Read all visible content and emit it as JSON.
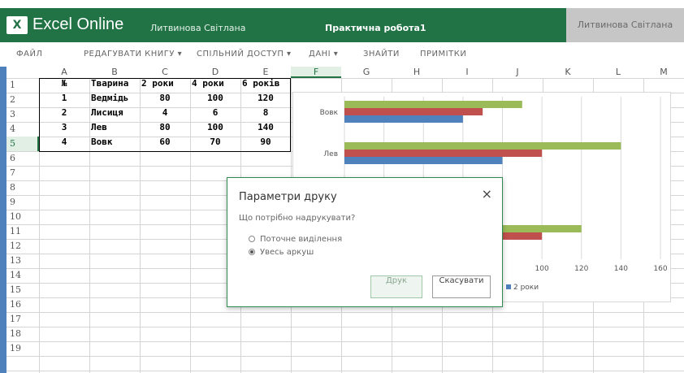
{
  "header": {
    "logo_text": "X",
    "app_name": "Excel Online",
    "user_left": "Литвинова Світлана",
    "document_title": "Практична робота1",
    "user_right": "Литвинова Світлана",
    "brand_color": "#217346"
  },
  "ribbon": {
    "items": [
      "ФАЙЛ",
      "РЕДАГУВАТИ КНИГУ ▾",
      "СПІЛЬНИЙ ДОСТУП ▾",
      "ДАНІ ▾",
      "ЗНАЙТИ",
      "ПРИМІТКИ"
    ]
  },
  "columns": [
    "A",
    "B",
    "C",
    "D",
    "E",
    "F",
    "G",
    "H",
    "I",
    "J",
    "K",
    "L",
    "M"
  ],
  "rows": [
    "1",
    "2",
    "3",
    "4",
    "5",
    "6",
    "7",
    "8",
    "9",
    "10",
    "11",
    "12",
    "13",
    "14",
    "15",
    "16",
    "17",
    "18",
    "19"
  ],
  "selected": {
    "column": "F",
    "row": "5"
  },
  "table": {
    "headers": [
      "№",
      "Тварина",
      "2 роки",
      "4 роки",
      "6 років"
    ],
    "rows": [
      [
        "1",
        "Ведмідь",
        "80",
        "100",
        "120"
      ],
      [
        "2",
        "Лисиця",
        "4",
        "6",
        "8"
      ],
      [
        "3",
        "Лев",
        "80",
        "100",
        "140"
      ],
      [
        "4",
        "Вовк",
        "60",
        "70",
        "90"
      ]
    ]
  },
  "chart_data": {
    "type": "bar",
    "orientation": "horizontal",
    "categories_visible": [
      "Вовк",
      "Лев"
    ],
    "series": [
      {
        "name": "2 роки",
        "color": "#4f81bd",
        "values": [
          60,
          80
        ]
      },
      {
        "name": "",
        "color": "#c0504d",
        "values": [
          70,
          100
        ]
      },
      {
        "name": "",
        "color": "#9bbb59",
        "values": [
          90,
          140
        ]
      }
    ],
    "partial_bars": [
      {
        "color": "#9bbb59",
        "value": 120
      },
      {
        "color": "#c0504d",
        "value": 100
      }
    ],
    "xlim": [
      0,
      160
    ],
    "x_ticks_visible": [
      "100",
      "120",
      "140",
      "160"
    ],
    "legend_visible": "2 роки",
    "legend_placement": "bottom",
    "grid": true
  },
  "dialog": {
    "title": "Параметри друку",
    "close_glyph": "×",
    "question": "Що потрібно надрукувати?",
    "option_selection": "Поточне виділення",
    "option_sheet": "Увесь аркуш",
    "print_label": "Друк",
    "cancel_label": "Скасувати"
  }
}
